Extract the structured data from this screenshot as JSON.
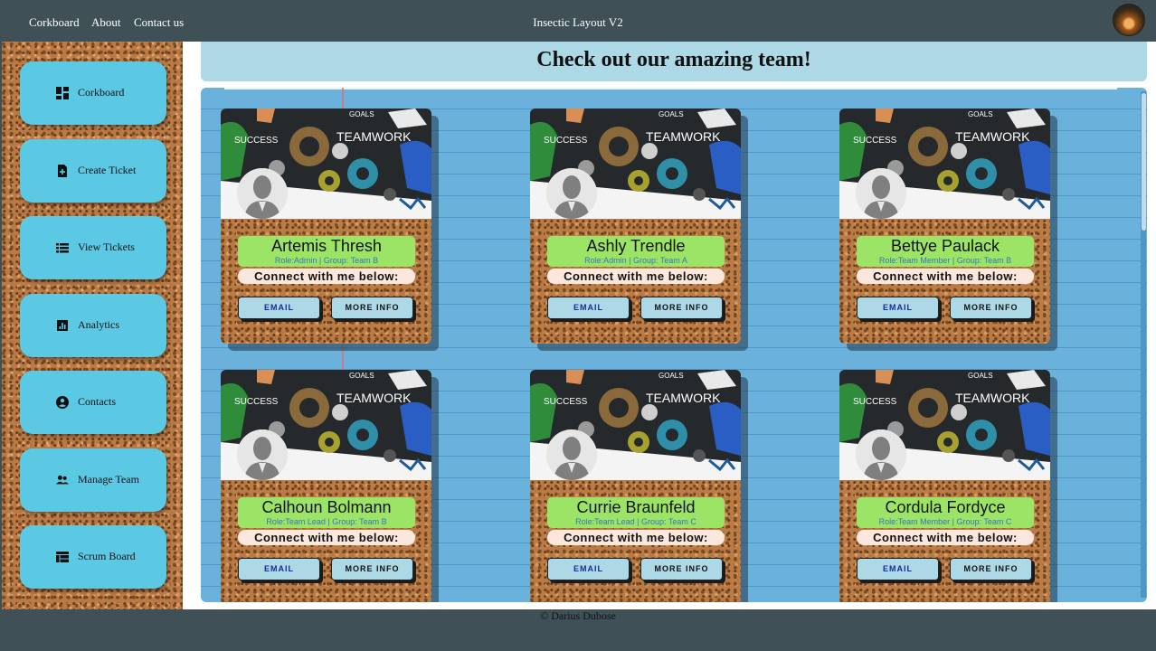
{
  "nav": {
    "links": [
      "Corkboard",
      "About",
      "Contact us"
    ],
    "brand": "Insectic Layout V2"
  },
  "sidebar": {
    "items": [
      {
        "label": "Corkboard",
        "icon": "dashboard-icon"
      },
      {
        "label": "Create Ticket",
        "icon": "file-add-icon"
      },
      {
        "label": "View Tickets",
        "icon": "list-icon"
      },
      {
        "label": "Analytics",
        "icon": "chart-icon"
      },
      {
        "label": "Contacts",
        "icon": "account-circle-icon"
      },
      {
        "label": "Manage Team",
        "icon": "people-icon"
      },
      {
        "label": "Scrum Board",
        "icon": "table-icon"
      }
    ]
  },
  "main": {
    "title": "Check out our amazing team!",
    "connect_label": "Connect with me below:",
    "email_label": "EMAIL",
    "info_label": "MORE INFO",
    "members": [
      {
        "name": "Artemis Thresh",
        "role": "Role:Admin | Group: Team B"
      },
      {
        "name": "Ashly Trendle",
        "role": "Role:Admin | Group: Team A"
      },
      {
        "name": "Bettye Paulack",
        "role": "Role:Team Member | Group: Team B"
      },
      {
        "name": "Calhoun Bolmann",
        "role": "Role:Team Lead | Group: Team B"
      },
      {
        "name": "Currie Braunfeld",
        "role": "Role:Team Lead | Group: Team C"
      },
      {
        "name": "Cordula Fordyce",
        "role": "Role:Team Member | Group: Team C"
      }
    ]
  },
  "footer": {
    "text": "© Darius Dubose"
  },
  "colors": {
    "topbar": "#3f5157",
    "sidebar_button": "#5bc8e4",
    "banner": "#add8e6",
    "panel": "#6ab2dc",
    "name_box": "#9be466"
  }
}
